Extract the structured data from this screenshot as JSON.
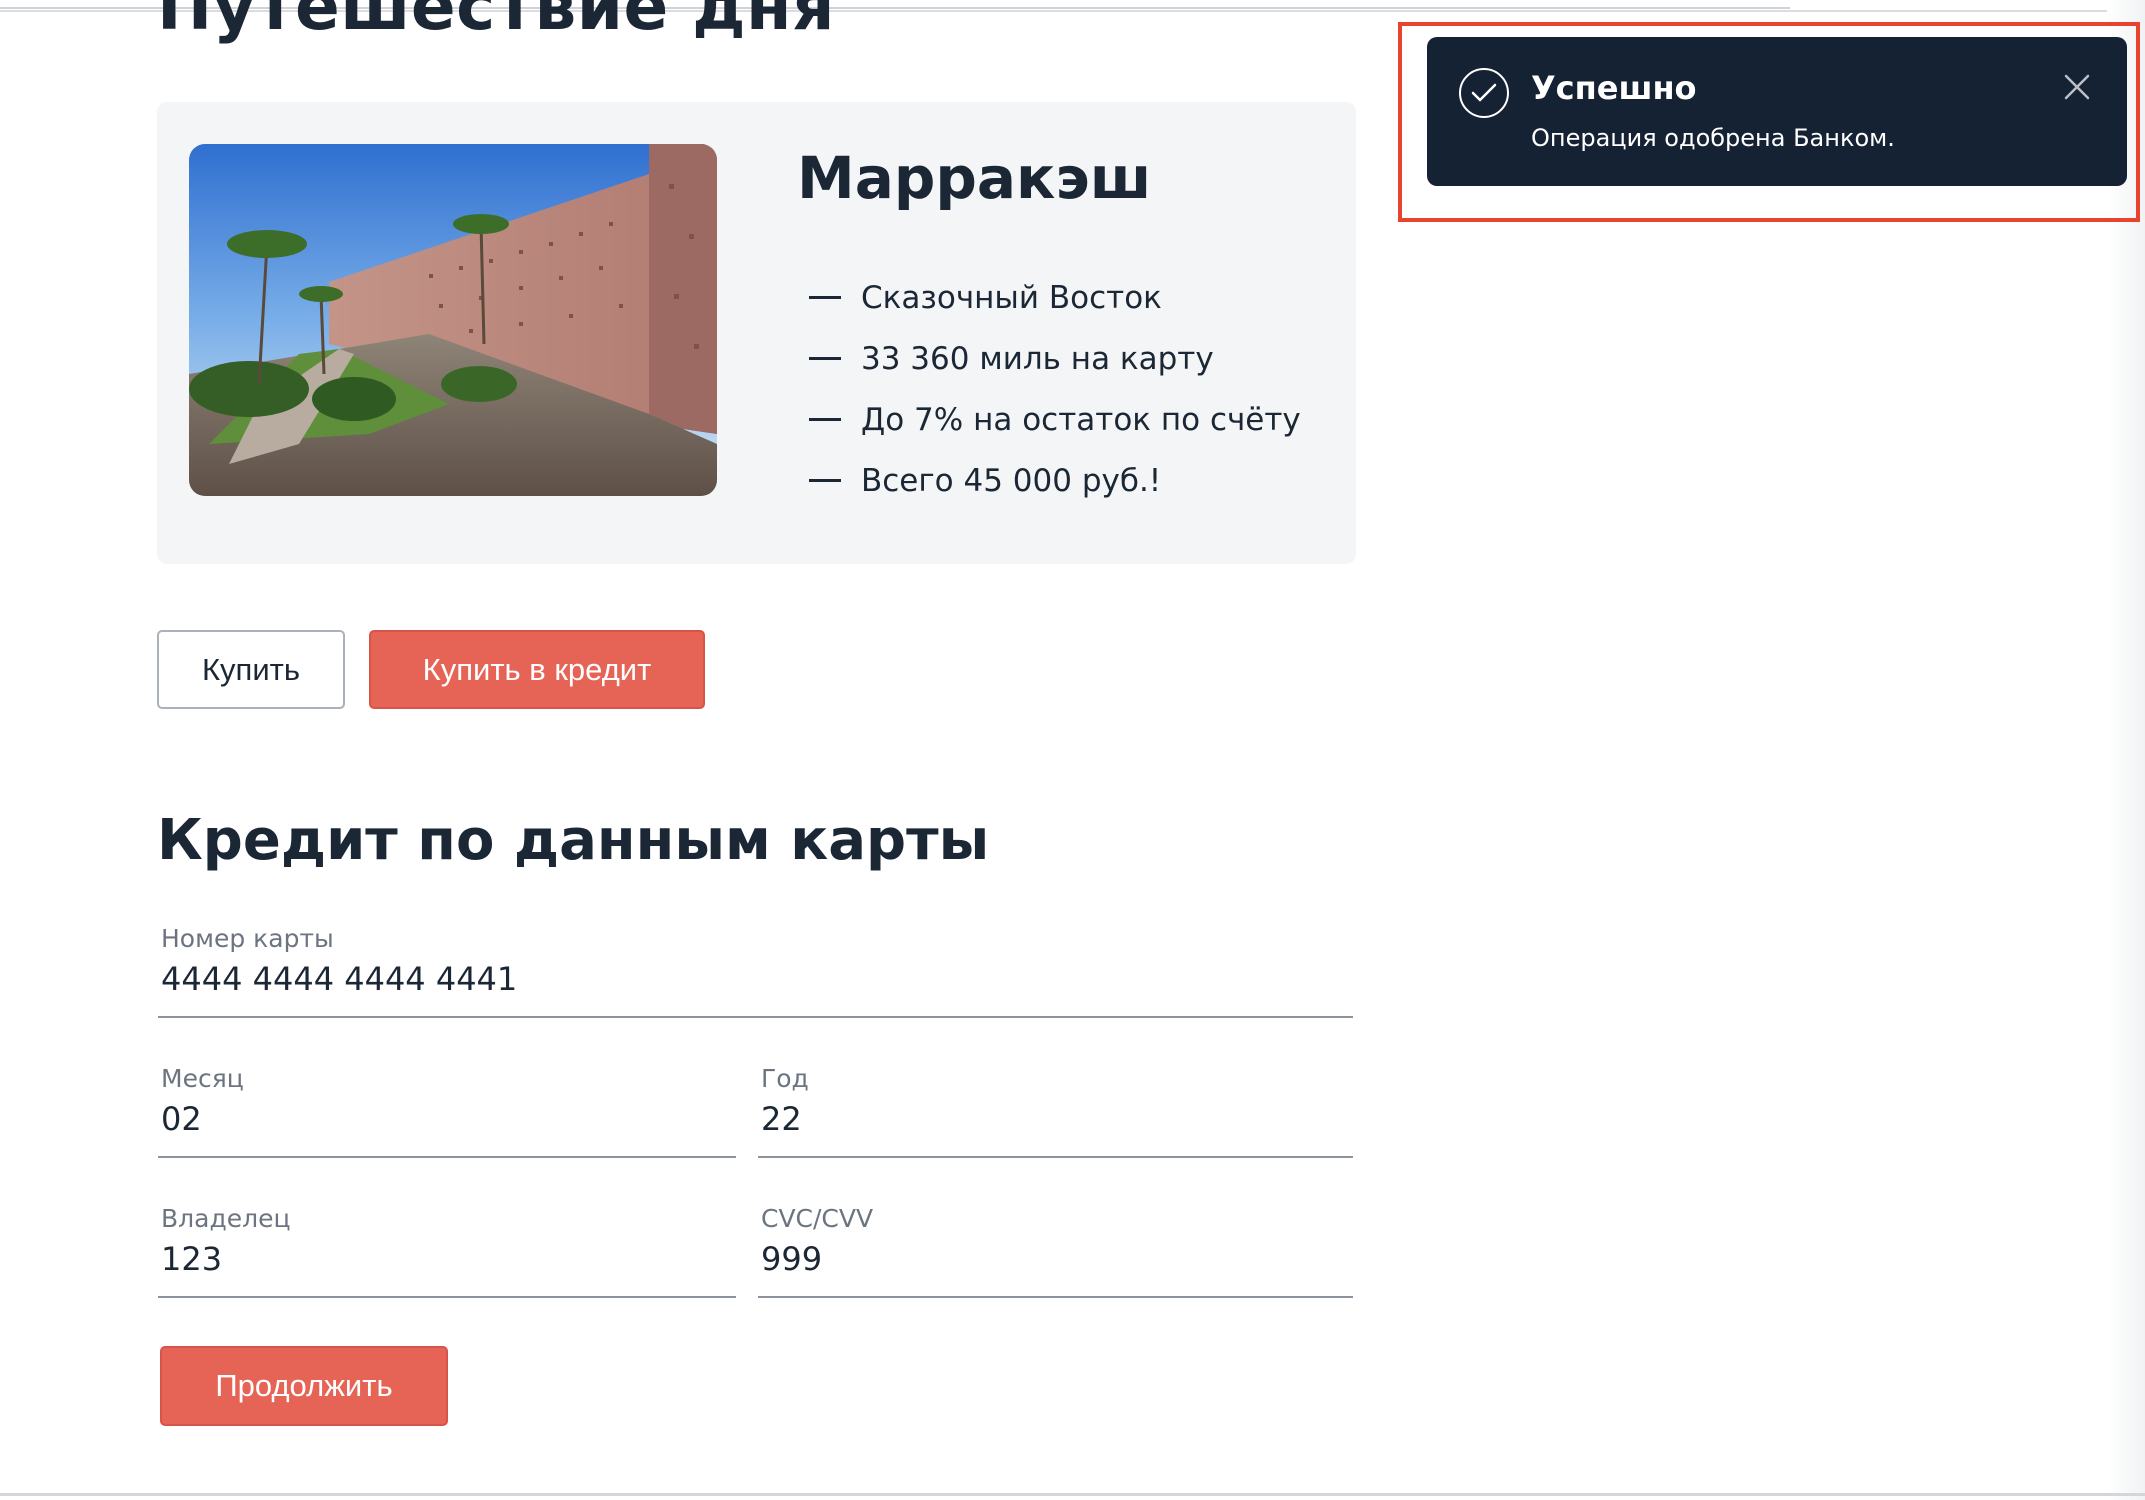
{
  "page": {
    "title": "Путешествие дня"
  },
  "tour": {
    "city": "Марракэш",
    "image_alt": "Стены Марракэша",
    "features": [
      "Сказочный Восток",
      "33 360 миль на карту",
      "До 7% на остаток по счёту",
      "Всего 45 000 руб.!"
    ]
  },
  "buttons": {
    "buy": "Купить",
    "buy_credit": "Купить в кредит",
    "continue": "Продолжить"
  },
  "form": {
    "title": "Кредит по данным карты",
    "card_number": {
      "label": "Номер карты",
      "value": "4444 4444 4444 4441"
    },
    "month": {
      "label": "Месяц",
      "value": "02"
    },
    "year": {
      "label": "Год",
      "value": "22"
    },
    "owner": {
      "label": "Владелец",
      "value": "123"
    },
    "cvc": {
      "label": "CVC/CVV",
      "value": "999"
    }
  },
  "notification": {
    "title": "Успешно",
    "text": "Операция одобрена Банком.",
    "icon": "check-circle-icon",
    "close_icon": "close-icon"
  },
  "colors": {
    "accent": "#e56456",
    "text": "#1b2735",
    "toast_bg": "#152234",
    "card_bg": "#f4f5f7",
    "highlight": "#e8432e"
  }
}
